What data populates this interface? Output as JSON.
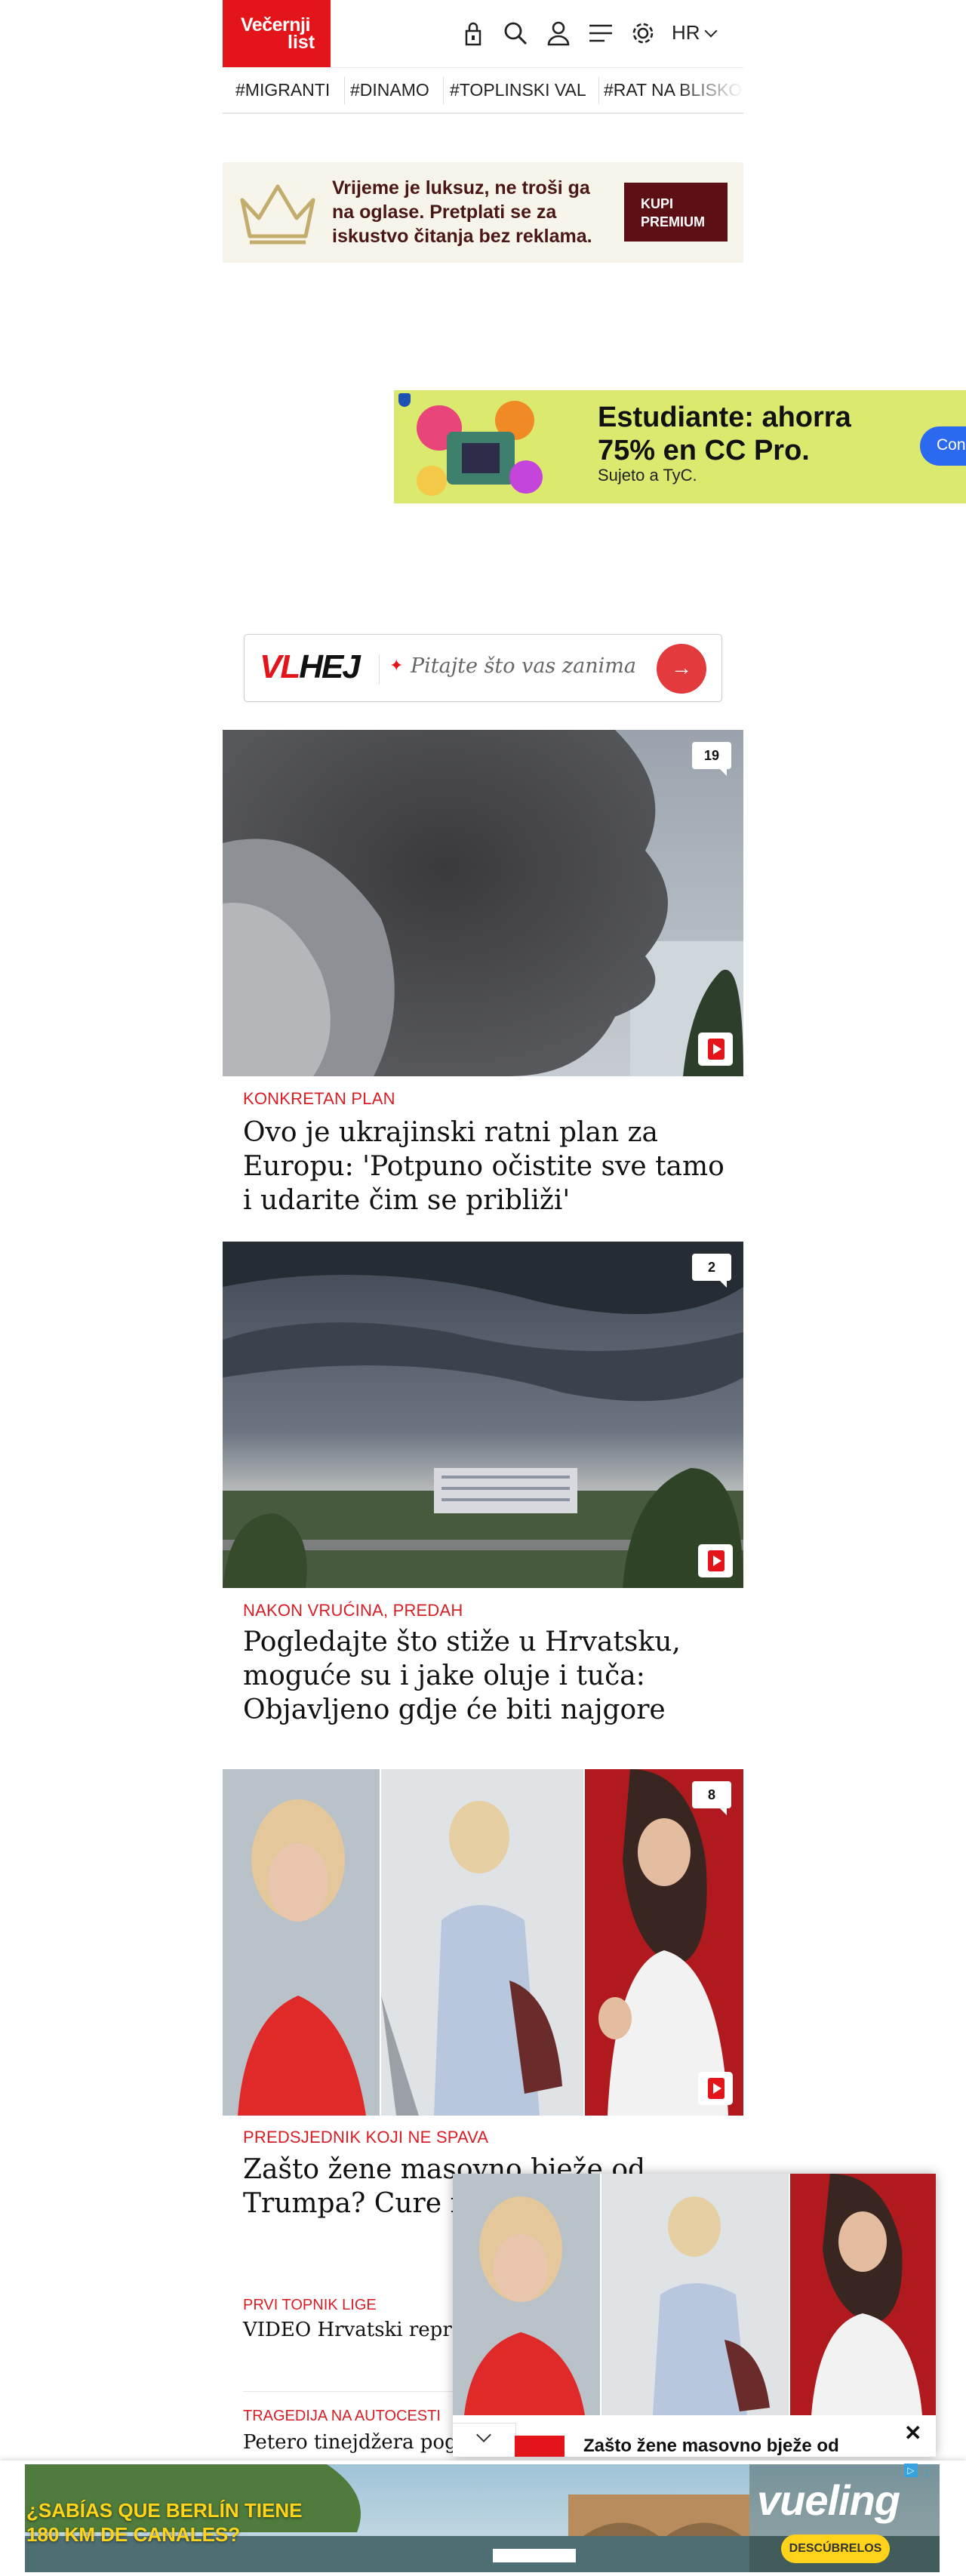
{
  "header": {
    "logo_line1": "Večernji",
    "logo_line2": "list",
    "language": "HR"
  },
  "tags": [
    "#MIGRANTI",
    "#DINAMO",
    "#TOPLINSKI VAL",
    "#RAT NA BLISKO"
  ],
  "premium": {
    "text": "Vrijeme je luksuz, ne troši ga na oglase. Pretplati se za iskustvo čitanja bez reklama.",
    "button": "KUPI PREMIUM"
  },
  "ad_cc": {
    "title": "Estudiante: ahorra 75% en CC Pro.",
    "subtitle": "Sujeto a TyC.",
    "button": "Con"
  },
  "vlhej": {
    "brand_vl": "VL",
    "brand_hej": "HEJ",
    "placeholder": "Pitajte što vas zanima"
  },
  "articles": [
    {
      "comments": "19",
      "kicker": "KONKRETAN PLAN",
      "title": "Ovo je ukrajinski ratni plan za Europu: 'Potpuno očistite sve tamo i udarite čim se približi'"
    },
    {
      "comments": "2",
      "kicker": "NAKON VRUĆINA, PREDAH",
      "title": "Pogledajte što stiže u Hrvatsku, moguće su i jake oluje i tuča: Objavljeno gdje će biti najgore"
    },
    {
      "comments": "8",
      "kicker": "PREDSJEDNIK KOJI NE SPAVA",
      "title": "Zašto žene masovno bježe od Trumpa? Cure n Bijele kuće: 'Zov"
    }
  ],
  "small_articles": [
    {
      "kicker": "PRVI TOPNIK LIGE",
      "title": "VIDEO Hrvatski reprez Zabio golčinu, a bolji je"
    },
    {
      "kicker": "TRAGEDIJA NA AUTOCESTI",
      "title": "Petero tinejdžera pogi"
    }
  ],
  "popup": {
    "title": "Zašto žene masovno bježe od",
    "close": "✕"
  },
  "bottom_ad": {
    "line1": "¿SABÍAS QUE BERLÍN TIENE",
    "line2": "180 KM DE CANALES?",
    "brand": "vueling",
    "cta": "DESCÚBRELOS"
  }
}
